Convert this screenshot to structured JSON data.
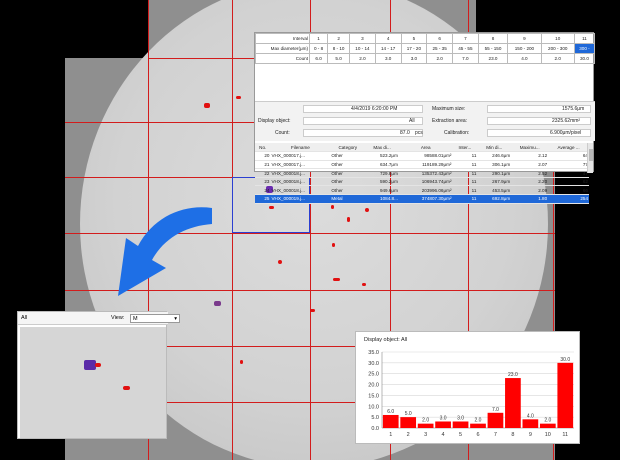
{
  "colors": {
    "particle": "#e11010",
    "grid": "#d21c1c",
    "selection": "#2b3fd1",
    "highlight_row": "#1f68d8",
    "arrow": "#1e6fe6",
    "bar": "#ff0000"
  },
  "interval_table": {
    "header_interval": "Interval",
    "header_diameter": "Max diameter(μm)",
    "header_count": "Count",
    "intervals": [
      "1",
      "2",
      "3",
      "4",
      "5",
      "6",
      "7",
      "8",
      "9",
      "10",
      "11"
    ],
    "diameters": [
      "0 - 8",
      "8 - 10",
      "10 - 14",
      "14 - 17",
      "17 - 20",
      "25 - 35",
      "45 - 55",
      "55 - 150",
      "150 - 200",
      "200 - 300",
      "300 -"
    ],
    "counts": [
      "6.0",
      "5.0",
      "2.0",
      "3.0",
      "3.0",
      "2.0",
      "7.0",
      "23.0",
      "4.0",
      "2.0",
      "30.0"
    ]
  },
  "summary": {
    "date": "4/4/2019 6:20:00 PM",
    "max_size_label": "Maximum size:",
    "max_size_value": "1575.6μm",
    "display_object_label": "Display object:",
    "display_object_value": "All",
    "extraction_area_label": "Extraction area:",
    "extraction_area_value": "2325.62mm²",
    "count_label": "Count:",
    "count_value": "87.0",
    "count_unit": "pcs",
    "calibration_label": "Calibration:",
    "calibration_value": "6.900μm/pixel"
  },
  "particle_table": {
    "headers": [
      "No.",
      "Filename",
      "Category",
      "Max di...",
      "Area",
      "Inter...",
      "Min di...",
      "Maximu...",
      "Average ..."
    ],
    "rows": [
      [
        "20",
        "VHX_000017.j...",
        "Other",
        "523.2μm",
        "98588.01μm²",
        "11",
        "246.6μm",
        "2.12",
        "64"
      ],
      [
        "21",
        "VHX_000017.j...",
        "Other",
        "634.7μm",
        "119189.29μm²",
        "11",
        "306.1μm",
        "2.07",
        "77"
      ],
      [
        "22",
        "VHX_000018.j...",
        "Other",
        "729.8μm",
        "135372.43μm²",
        "11",
        "290.1μm",
        "2.52",
        "47"
      ],
      [
        "23",
        "VHX_000018.j...",
        "Other",
        "590.2μm",
        "106943.74μm²",
        "11",
        "267.9μm",
        "2.20",
        "62"
      ],
      [
        "24",
        "VHX_000018.j...",
        "Other",
        "949.6μm",
        "203996.06μm²",
        "11",
        "453.5μm",
        "2.09",
        "66"
      ],
      [
        "25",
        "VHX_000019.j...",
        "Metal",
        "1084.8...",
        "374807.30μm²",
        "11",
        "692.8μm",
        "1.80",
        "254"
      ]
    ],
    "selected_row": 5
  },
  "thumbnail": {
    "filter_label": "All",
    "view_label": "View:",
    "view_value": "M"
  },
  "histogram": {
    "title": "Display object: All"
  },
  "chart_data": {
    "type": "bar",
    "title": "Display object: All",
    "categories": [
      "1",
      "2",
      "3",
      "4",
      "5",
      "6",
      "7",
      "8",
      "9",
      "10",
      "11"
    ],
    "values": [
      6.0,
      5.0,
      2.0,
      3.0,
      3.0,
      2.0,
      7.0,
      23.0,
      4.0,
      2.0,
      30.0
    ],
    "data_labels": [
      "6.0",
      "5.0",
      "2.0",
      "3.0",
      "3.0",
      "2.0",
      "7.0",
      "23.0",
      "4.0",
      "2.0",
      "30.0"
    ],
    "yticks": [
      "0.0",
      "5.0",
      "10.0",
      "15.0",
      "20.0",
      "25.0",
      "30.0",
      "35.0"
    ],
    "ylim": [
      0,
      35
    ],
    "xlabel": "",
    "ylabel": "",
    "grid": true
  }
}
